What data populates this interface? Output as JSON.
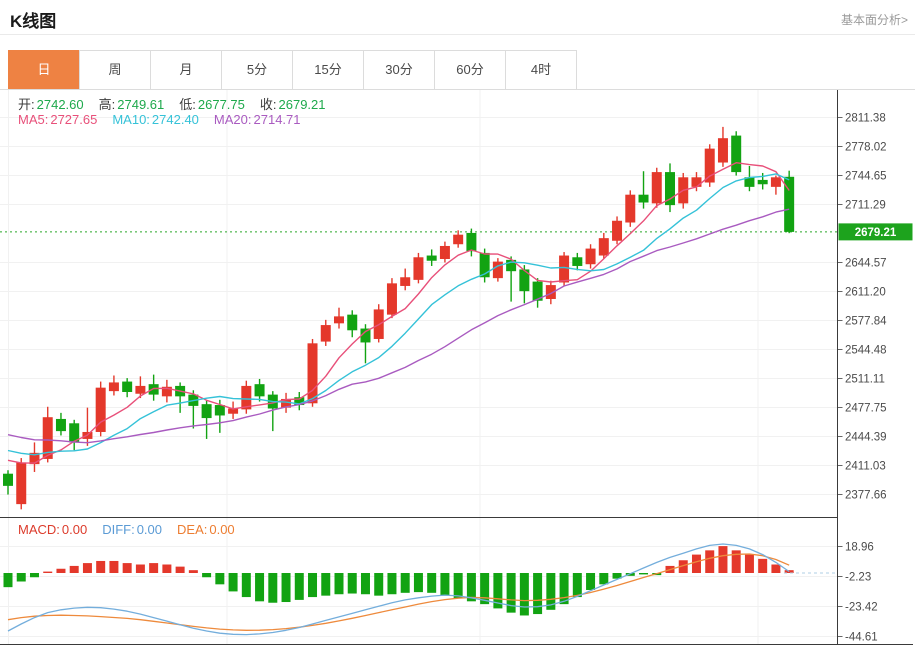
{
  "header": {
    "title": "K线图",
    "link": "基本面分析>"
  },
  "tabs": {
    "items": [
      "日",
      "周",
      "月",
      "5分",
      "15分",
      "30分",
      "60分",
      "4时"
    ],
    "selected": 0,
    "active_color": "#ee8243"
  },
  "legend_ohlc": {
    "value_color": "#1ea94c",
    "items": [
      {
        "label": "开:",
        "value": "2742.60"
      },
      {
        "label": "高:",
        "value": "2749.61"
      },
      {
        "label": "低:",
        "value": "2677.75"
      },
      {
        "label": "收:",
        "value": "2679.21"
      }
    ]
  },
  "legend_ma": {
    "items": [
      {
        "label": "MA5:",
        "value": "2727.65",
        "color": "#e8507a"
      },
      {
        "label": "MA10:",
        "value": "2742.40",
        "color": "#35c2d8"
      },
      {
        "label": "MA20:",
        "value": "2714.71",
        "color": "#a95bc0"
      }
    ]
  },
  "legend_macd": {
    "items": [
      {
        "label": "MACD:",
        "value": "0.00",
        "color": "#dc3b2b"
      },
      {
        "label": "DIFF:",
        "value": "0.00",
        "color": "#5b9bd5"
      },
      {
        "label": "DEA:",
        "value": "0.00",
        "color": "#ed7d31"
      }
    ]
  },
  "chart_data": {
    "type": "candlestick+macd",
    "title": "K线图 日线 (daily gold K-line)",
    "current_price": 2679.21,
    "current_price_label": "2679.21",
    "main_axis_ticks": [
      "2811.38",
      "2778.02",
      "2744.65",
      "2711.29",
      "2644.57",
      "2611.20",
      "2577.84",
      "2544.48",
      "2511.11",
      "2477.75",
      "2444.39",
      "2411.03",
      "2377.66"
    ],
    "macd_axis_ticks": [
      "18.96",
      "-2.23",
      "-23.42",
      "-44.61"
    ],
    "grid_x": [
      227,
      480,
      758
    ],
    "colors": {
      "up": "#e4382b",
      "down": "#12a312",
      "price_tag": "#1da31d",
      "dotted_line": "#2aa62a",
      "ma5": "#e8507a",
      "ma10": "#35c2d8",
      "ma20": "#a95bc0",
      "diff_line": "#74aedc",
      "dea_line": "#ee8a3c",
      "grid": "#f1f1f1",
      "frame": "#3a3a3a"
    },
    "candles_format": "[open, close, high, low]",
    "candles": [
      [
        2401,
        2387,
        2405,
        2377
      ],
      [
        2366,
        2414,
        2419,
        2360
      ],
      [
        2412,
        2425,
        2437,
        2403
      ],
      [
        2418,
        2466,
        2478,
        2414
      ],
      [
        2464,
        2450,
        2471,
        2445
      ],
      [
        2459,
        2437,
        2463,
        2428
      ],
      [
        2441,
        2449,
        2477,
        2433
      ],
      [
        2449,
        2500,
        2507,
        2444
      ],
      [
        2496,
        2506,
        2514,
        2491
      ],
      [
        2507,
        2495,
        2511,
        2489
      ],
      [
        2493,
        2502,
        2513,
        2488
      ],
      [
        2504,
        2492,
        2515,
        2485
      ],
      [
        2490,
        2501,
        2509,
        2483
      ],
      [
        2502,
        2490,
        2506,
        2471
      ],
      [
        2492,
        2479,
        2497,
        2453
      ],
      [
        2481,
        2465,
        2485,
        2441
      ],
      [
        2480,
        2468,
        2486,
        2448
      ],
      [
        2470,
        2476,
        2484,
        2464
      ],
      [
        2475,
        2502,
        2508,
        2470
      ],
      [
        2504,
        2490,
        2510,
        2484
      ],
      [
        2492,
        2476,
        2496,
        2450
      ],
      [
        2477,
        2487,
        2494,
        2471
      ],
      [
        2489,
        2480,
        2495,
        2474
      ],
      [
        2482,
        2551,
        2556,
        2478
      ],
      [
        2553,
        2572,
        2578,
        2548
      ],
      [
        2574,
        2582,
        2592,
        2568
      ],
      [
        2584,
        2566,
        2589,
        2558
      ],
      [
        2568,
        2552,
        2573,
        2528
      ],
      [
        2556,
        2590,
        2596,
        2552
      ],
      [
        2584,
        2620,
        2626,
        2580
      ],
      [
        2617,
        2627,
        2637,
        2612
      ],
      [
        2624,
        2650,
        2655,
        2620
      ],
      [
        2652,
        2646,
        2659,
        2640
      ],
      [
        2648,
        2663,
        2668,
        2644
      ],
      [
        2665,
        2676,
        2681,
        2661
      ],
      [
        2678,
        2657,
        2683,
        2651
      ],
      [
        2655,
        2627,
        2660,
        2621
      ],
      [
        2626,
        2645,
        2649,
        2622
      ],
      [
        2647,
        2634,
        2651,
        2599
      ],
      [
        2636,
        2611,
        2641,
        2597
      ],
      [
        2622,
        2600,
        2626,
        2592
      ],
      [
        2602,
        2618,
        2623,
        2596
      ],
      [
        2621,
        2652,
        2656,
        2617
      ],
      [
        2650,
        2640,
        2655,
        2635
      ],
      [
        2642,
        2660,
        2665,
        2637
      ],
      [
        2652,
        2672,
        2678,
        2648
      ],
      [
        2669,
        2692,
        2697,
        2665
      ],
      [
        2690,
        2722,
        2727,
        2685
      ],
      [
        2722,
        2713,
        2749,
        2706
      ],
      [
        2712,
        2748,
        2753,
        2707
      ],
      [
        2748,
        2710,
        2758,
        2702
      ],
      [
        2712,
        2742,
        2747,
        2706
      ],
      [
        2731,
        2742,
        2748,
        2726
      ],
      [
        2736,
        2775,
        2780,
        2731
      ],
      [
        2759,
        2787,
        2800,
        2754
      ],
      [
        2790,
        2748,
        2795,
        2744
      ],
      [
        2742,
        2731,
        2755,
        2726
      ],
      [
        2739,
        2734,
        2747,
        2728
      ],
      [
        2731,
        2742,
        2744,
        2722
      ],
      [
        2742.6,
        2679.21,
        2749.61,
        2677.75
      ]
    ],
    "ma_periods": [
      5,
      10,
      20
    ],
    "ma_warmup_closes": [
      2482,
      2479,
      2476,
      2472,
      2469,
      2466,
      2462,
      2459,
      2456,
      2452,
      2449,
      2446,
      2442,
      2439,
      2436,
      2432,
      2429,
      2426,
      2422,
      2418
    ],
    "macd": {
      "hist": [
        -10,
        -6,
        -3,
        1,
        3,
        5,
        7,
        8.5,
        8.5,
        7,
        6,
        7,
        6,
        4.5,
        2,
        -3,
        -8,
        -13,
        -17,
        -20,
        -21,
        -20.5,
        -19,
        -17,
        -16,
        -15,
        -14.5,
        -15,
        -16,
        -15,
        -14,
        -13.5,
        -14,
        -16,
        -18,
        -20,
        -22,
        -25,
        -28,
        -30,
        -29,
        -26,
        -22,
        -17,
        -12,
        -8,
        -4,
        -2,
        -1,
        -1.5,
        5,
        9,
        13,
        16,
        19,
        16,
        13,
        10,
        6,
        2
      ],
      "diff": [
        -41,
        -36,
        -31.5,
        -28,
        -26,
        -24.8,
        -24.2,
        -24.5,
        -25.5,
        -27,
        -29,
        -31.5,
        -34,
        -36.5,
        -39,
        -41,
        -42.5,
        -43.3,
        -43.5,
        -43,
        -42,
        -40.5,
        -38.5,
        -36,
        -33.5,
        -31,
        -28.5,
        -26,
        -23.5,
        -21,
        -19,
        -17.5,
        -16.3,
        -15.6,
        -16.2,
        -17.5,
        -19.3,
        -21.2,
        -23,
        -24,
        -23.8,
        -22.5,
        -20,
        -16.5,
        -12.5,
        -8.5,
        -4.5,
        -0.5,
        3.5,
        7.5,
        11,
        14,
        17,
        19.5,
        20.5,
        19.5,
        17,
        13,
        7.5,
        1
      ],
      "dea": [
        -33,
        -31.5,
        -30.5,
        -30,
        -29.8,
        -30,
        -30.3,
        -30.8,
        -31.4,
        -32.1,
        -33,
        -34.1,
        -35.3,
        -36.5,
        -37.7,
        -38.8,
        -39.6,
        -40.2,
        -40.5,
        -40.4,
        -40,
        -39.3,
        -38.3,
        -37,
        -35.5,
        -33.8,
        -32,
        -30,
        -28,
        -26,
        -24,
        -22,
        -20.2,
        -18.8,
        -17.8,
        -17.2,
        -17.5,
        -18.2,
        -19,
        -19.5,
        -19.3,
        -18.6,
        -17.4,
        -15.8,
        -13.8,
        -11.4,
        -8.8,
        -6,
        -3.2,
        -0.4,
        2.4,
        5.2,
        8,
        10.4,
        12.2,
        13.2,
        13.4,
        12.2,
        9.5,
        5.5
      ]
    },
    "main_y_range": [
      2351,
      2842
    ],
    "grid": true,
    "legend_position": "top-left-overlay"
  }
}
